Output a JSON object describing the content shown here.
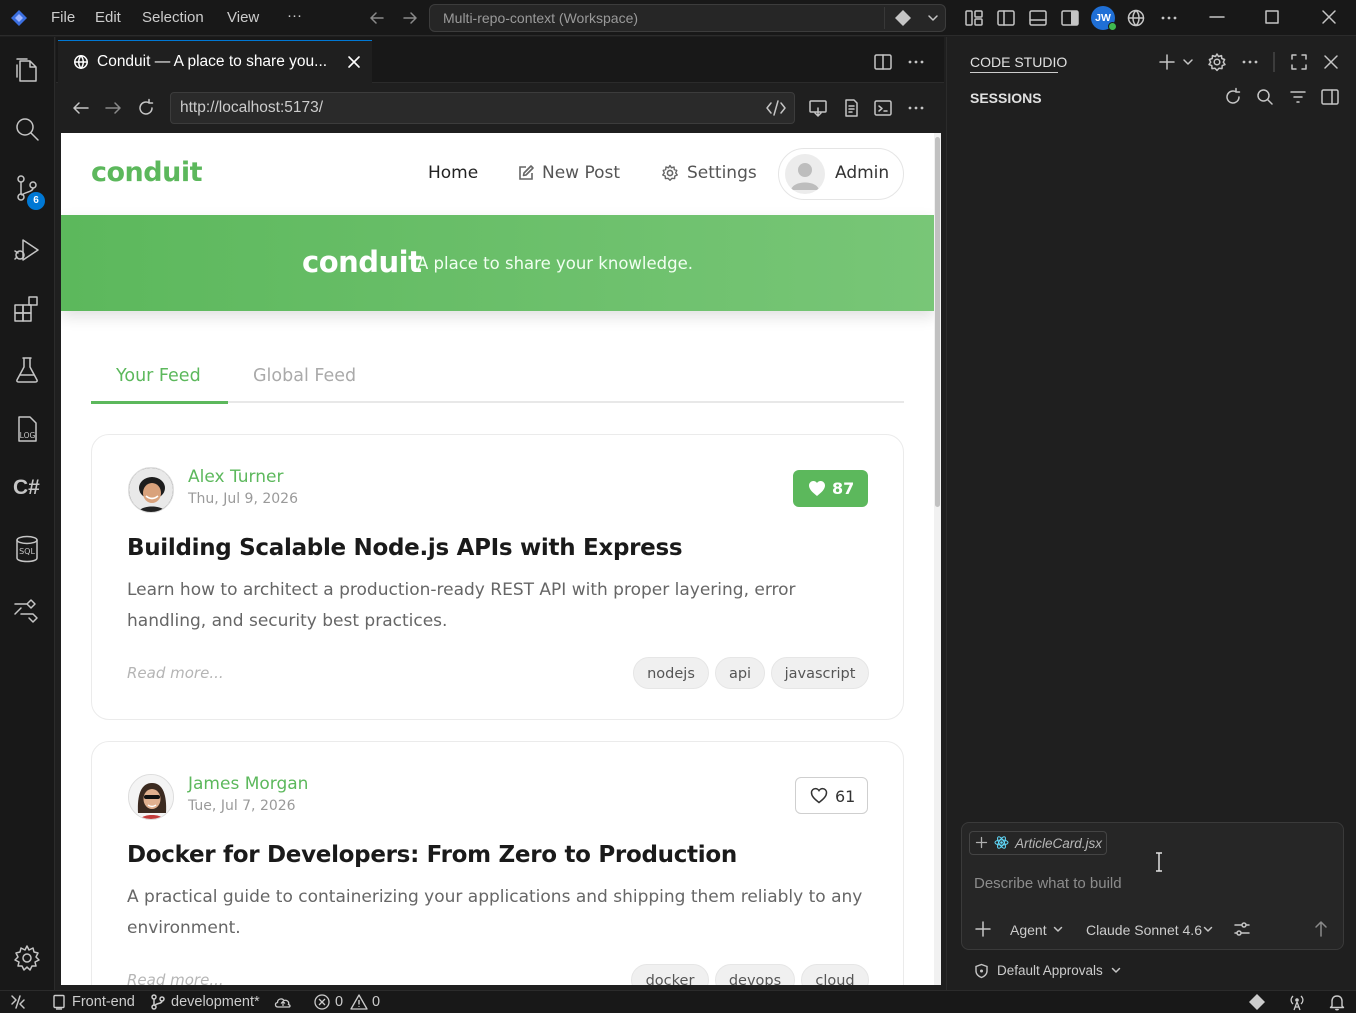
{
  "titlebar": {
    "menu": [
      "File",
      "Edit",
      "Selection",
      "View",
      "···"
    ],
    "command_center": "Multi-repo-context (Workspace)",
    "account_initials": "JW"
  },
  "activity_bar": {
    "scm_badge": "6",
    "log_label": "LOG",
    "csharp_label": "C#",
    "sql_label": "SQL"
  },
  "editor": {
    "tab_title": "Conduit — A place to share you...",
    "url": "http://localhost:5173/"
  },
  "site": {
    "brand": "conduit",
    "nav": {
      "home": "Home",
      "new_post": "New Post",
      "settings": "Settings",
      "user": "Admin"
    },
    "banner": {
      "brand": "conduit",
      "tagline": "A place to share your knowledge."
    },
    "feed_tabs": {
      "your_feed": "Your Feed",
      "global_feed": "Global Feed"
    },
    "articles": [
      {
        "author": "Alex Turner",
        "date": "Thu, Jul 9, 2026",
        "likes": "87",
        "liked": true,
        "title": "Building Scalable Node.js APIs with Express",
        "description": "Learn how to architect a production-ready REST API with proper layering, error handling, and security best practices.",
        "read_more": "Read more...",
        "tags": [
          "nodejs",
          "api",
          "javascript"
        ]
      },
      {
        "author": "James Morgan",
        "date": "Tue, Jul 7, 2026",
        "likes": "61",
        "liked": false,
        "title": "Docker for Developers: From Zero to Production",
        "description": "A practical guide to containerizing your applications and shipping them reliably to any environment.",
        "read_more": "Read more...",
        "tags": [
          "docker",
          "devops",
          "cloud"
        ]
      }
    ],
    "accent": "#5cb85c"
  },
  "code_studio": {
    "title": "CODE STUDIO",
    "sessions": "SESSIONS",
    "context_file": "ArticleCard.jsx",
    "placeholder": "Describe what to build",
    "mode": "Agent",
    "model": "Claude Sonnet 4.6",
    "approvals": "Default Approvals"
  },
  "statusbar": {
    "folder": "Front-end",
    "branch": "development*",
    "errors": "0",
    "warnings": "0"
  }
}
